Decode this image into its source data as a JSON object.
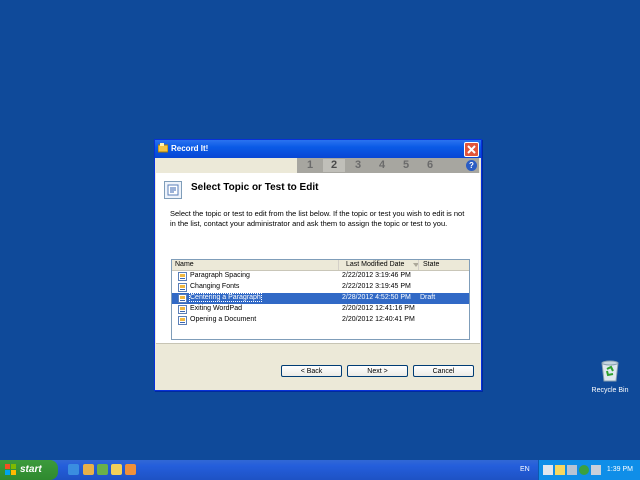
{
  "desktop": {
    "recycle_bin_label": "Recycle Bin"
  },
  "window": {
    "title": "Record It!",
    "steps": [
      "1",
      "2",
      "3",
      "4",
      "5",
      "6"
    ],
    "active_step": "2",
    "help": "?",
    "heading": "Select Topic or Test to Edit",
    "description": "Select the topic or test to edit from the list below. If the topic or test you wish to edit is not in the list, contact your administrator and ask them to assign the topic or test to you.",
    "columns": {
      "name": "Name",
      "modified": "Last Modified Date",
      "state": "State"
    },
    "rows": [
      {
        "name": "Paragraph Spacing",
        "modified": "2/22/2012 3:19:46 PM",
        "state": ""
      },
      {
        "name": "Changing Fonts",
        "modified": "2/22/2012 3:19:45 PM",
        "state": ""
      },
      {
        "name": "Centering a Paragraph",
        "modified": "2/28/2012 4:52:50 PM",
        "state": "Draft"
      },
      {
        "name": "Exiting WordPad",
        "modified": "2/20/2012 12:41:16 PM",
        "state": ""
      },
      {
        "name": "Opening a Document",
        "modified": "2/20/2012 12:40:41 PM",
        "state": ""
      }
    ],
    "selected_row": 2,
    "buttons": {
      "back": "< Back",
      "next": "Next >",
      "cancel": "Cancel"
    }
  },
  "taskbar": {
    "start": "start",
    "language": "EN",
    "time": "1:39 PM"
  },
  "colors": {
    "desktop": "#0f4a9a",
    "selection": "#3169c6",
    "titlebar": "#0a5ae6"
  }
}
